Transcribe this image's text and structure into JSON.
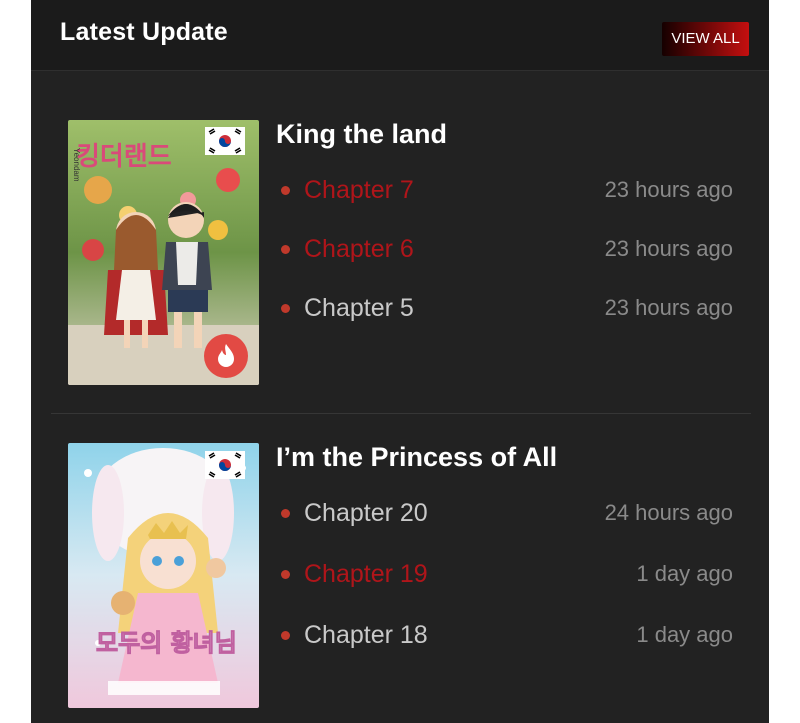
{
  "header": {
    "title": "Latest Update",
    "view_all": "VIEW ALL"
  },
  "items": [
    {
      "title": "King the land",
      "cover_text": "킹더랜드",
      "chapters": [
        {
          "label": "Chapter 7",
          "time": "23 hours ago",
          "highlight": true
        },
        {
          "label": "Chapter 6",
          "time": "23 hours ago",
          "highlight": true
        },
        {
          "label": "Chapter 5",
          "time": "23 hours ago",
          "highlight": false
        }
      ]
    },
    {
      "title": "I’m the Princess of All",
      "cover_text": "모두의 황녀님",
      "chapters": [
        {
          "label": "Chapter 20",
          "time": "24 hours ago",
          "highlight": false
        },
        {
          "label": "Chapter 19",
          "time": "1 day ago",
          "highlight": true
        },
        {
          "label": "Chapter 18",
          "time": "1 day ago",
          "highlight": false
        }
      ]
    }
  ],
  "colors": {
    "accent": "#b0151a",
    "panel": "#222222",
    "text_muted": "#8a8a8a"
  },
  "icons": {
    "flag": "south-korea-flag-icon",
    "hot": "fire-icon"
  }
}
